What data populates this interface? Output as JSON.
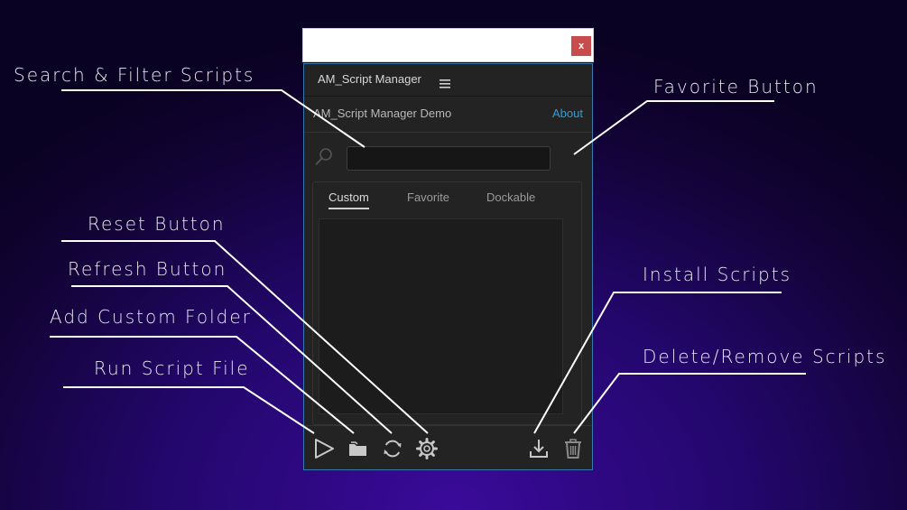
{
  "window": {
    "close_label": "x"
  },
  "panel": {
    "title": "AM_Script Manager",
    "subtitle": "AM_Script Manager Demo",
    "about_label": "About",
    "search": {
      "value": "",
      "placeholder": ""
    },
    "tabs": [
      {
        "label": "Custom",
        "active": true
      },
      {
        "label": "Favorite",
        "active": false
      },
      {
        "label": "Dockable",
        "active": false
      }
    ],
    "toolbar": {
      "left_tools": [
        "play-icon",
        "folder-icon",
        "refresh-icon",
        "gear-icon"
      ],
      "right_tools": [
        "download-icon",
        "trash-icon"
      ]
    }
  },
  "callouts": {
    "search_filter": "Search & Filter Scripts",
    "favorite_button": "Favorite Button",
    "reset_button": "Reset Button",
    "refresh_button": "Refresh Button",
    "add_custom_folder": "Add Custom Folder",
    "run_script_file": "Run Script File",
    "install_scripts": "Install Scripts",
    "delete_remove_scripts": "Delete/Remove Scripts"
  },
  "colors": {
    "background": "#24076e",
    "panel": "#232323",
    "accent_link": "#2f9fd6",
    "close_button": "#c94c4c",
    "panel_border": "#3a78b0"
  }
}
